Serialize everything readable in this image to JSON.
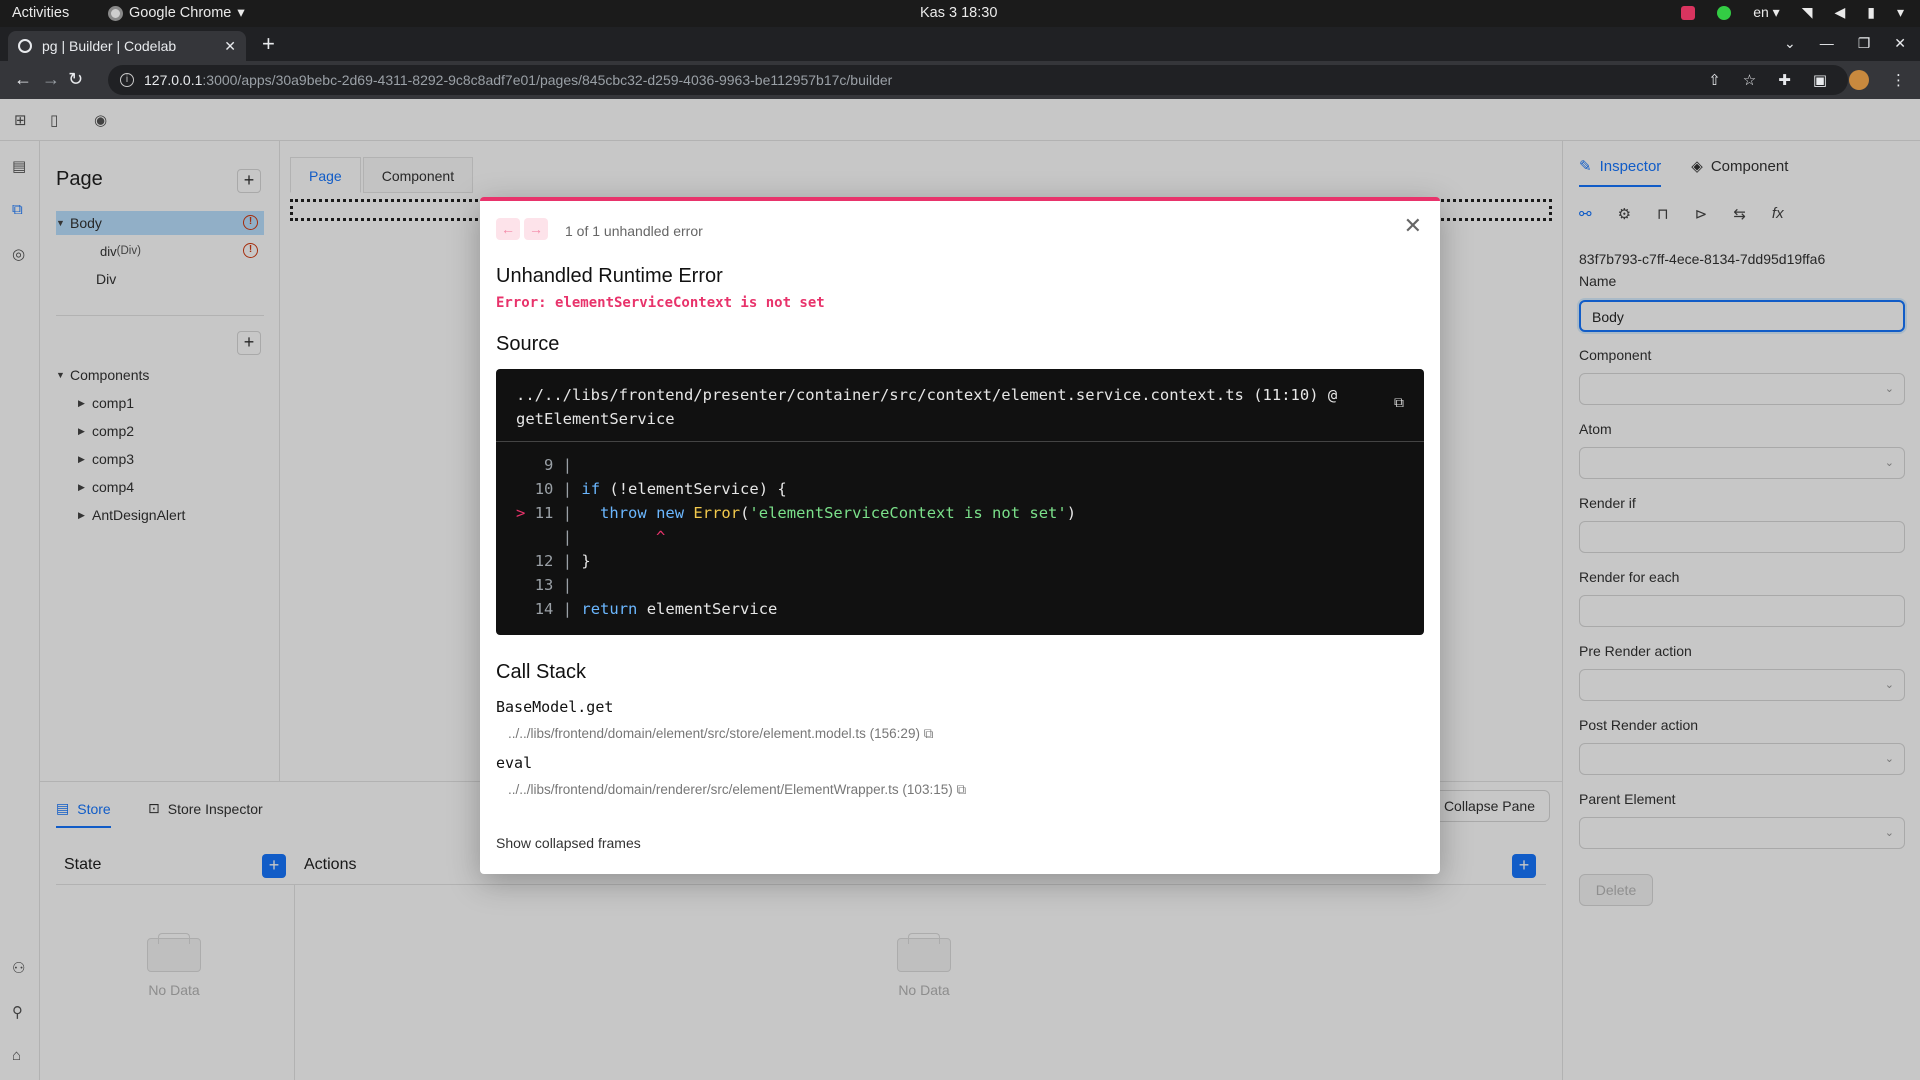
{
  "system": {
    "activities": "Activities",
    "app_name": "Google Chrome",
    "clock": "Kas 3  18:30",
    "lang": "en"
  },
  "browser": {
    "tab_title": "pg | Builder | Codelab",
    "url_host": "127.0.0.1",
    "url_path": ":3000/apps/30a9bebc-2d69-4311-8292-9c8c8adf7e01/pages/845cbc32-d259-4036-9963-be112957b17c/builder"
  },
  "explorer": {
    "title": "Page",
    "tree": [
      {
        "label": "Body",
        "suffix": "",
        "error": true
      },
      {
        "label": "div",
        "suffix": " (Div)",
        "error": true
      },
      {
        "label": "Div",
        "suffix": "",
        "error": false
      }
    ],
    "components_label": "Components",
    "components": [
      "comp1",
      "comp2",
      "comp3",
      "comp4",
      "AntDesignAlert"
    ]
  },
  "canvas": {
    "tabs": [
      "Page",
      "Component"
    ]
  },
  "bottom": {
    "tabs": [
      "Store",
      "Store Inspector"
    ],
    "collapse_label": "Collapse Pane",
    "state_title": "State",
    "actions_title": "Actions",
    "empty_text": "No Data"
  },
  "inspector": {
    "tabs": [
      "Inspector",
      "Component"
    ],
    "element_id": "83f7b793-c7ff-4ece-8134-7dd95d19ffa6",
    "name_label": "Name",
    "name_value": "Body",
    "fields": [
      "Component",
      "Atom",
      "Render if",
      "Render for each",
      "Pre Render action",
      "Post Render action",
      "Parent Element"
    ],
    "delete_label": "Delete"
  },
  "error_modal": {
    "count_text": "1 of 1 unhandled error",
    "title": "Unhandled Runtime Error",
    "message": "Error: elementServiceContext is not set",
    "source_heading": "Source",
    "source_file": "../../libs/frontend/presenter/container/src/context/element.service.context.ts (11:10) @ getElementService",
    "code": [
      {
        "ptr": " ",
        "num": " 9",
        "text": ""
      },
      {
        "ptr": " ",
        "num": "10",
        "text": "if (!elementService) {"
      },
      {
        "ptr": ">",
        "num": "11",
        "text": "  throw new Error('elementServiceContext is not set')"
      },
      {
        "ptr": " ",
        "num": "  ",
        "text": "        ^"
      },
      {
        "ptr": " ",
        "num": "12",
        "text": "}"
      },
      {
        "ptr": " ",
        "num": "13",
        "text": ""
      },
      {
        "ptr": " ",
        "num": "14",
        "text": "return elementService"
      }
    ],
    "stack_heading": "Call Stack",
    "frames": [
      {
        "name": "BaseModel.get",
        "file": "../../libs/frontend/domain/element/src/store/element.model.ts (156:29)"
      },
      {
        "name": "eval",
        "file": "../../libs/frontend/domain/renderer/src/element/ElementWrapper.ts (103:15)"
      }
    ],
    "show_collapsed": "Show collapsed frames"
  }
}
